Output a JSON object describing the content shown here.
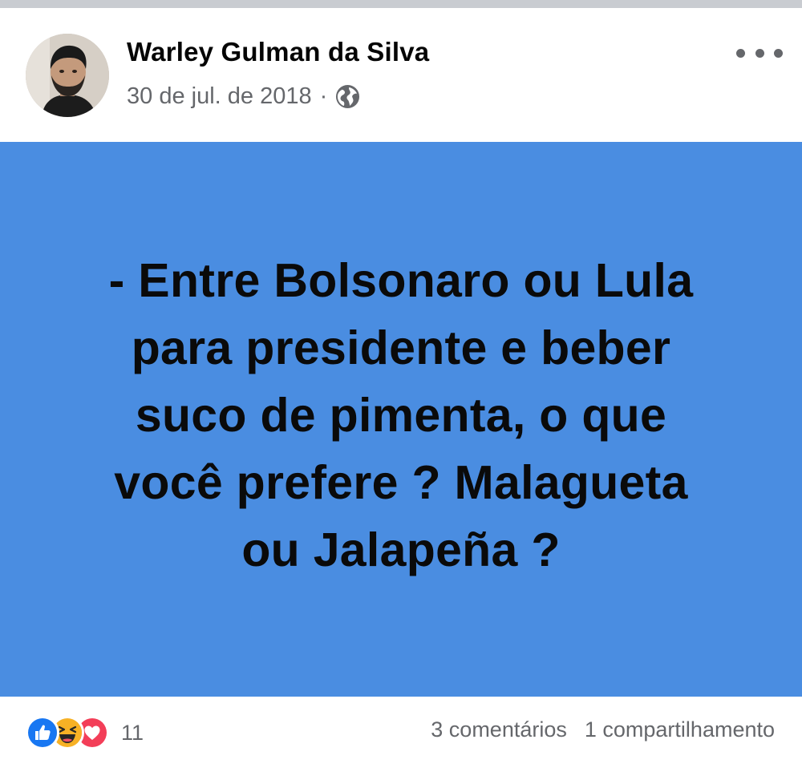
{
  "post": {
    "author": "Warley Gulman da Silva",
    "date": "30 de jul. de 2018",
    "separator": "·",
    "privacy_icon": "globe-icon",
    "options_icon": "more-options-icon",
    "image_text": "- Entre Bolsonaro ou Lula\npara presidente e beber\nsuco de pimenta, o que\nvocê prefere ? Malagueta\nou Jalapeña ?",
    "image_background": "#4a8de1"
  },
  "footer": {
    "reactions": [
      "like-icon",
      "haha-icon",
      "love-icon"
    ],
    "reaction_count": "11",
    "comments": "3 comentários",
    "shares": "1 compartilhamento"
  },
  "colors": {
    "like": "#1877f2",
    "haha": "#f7b125",
    "love": "#f33e58",
    "meta_text": "#65676b"
  }
}
